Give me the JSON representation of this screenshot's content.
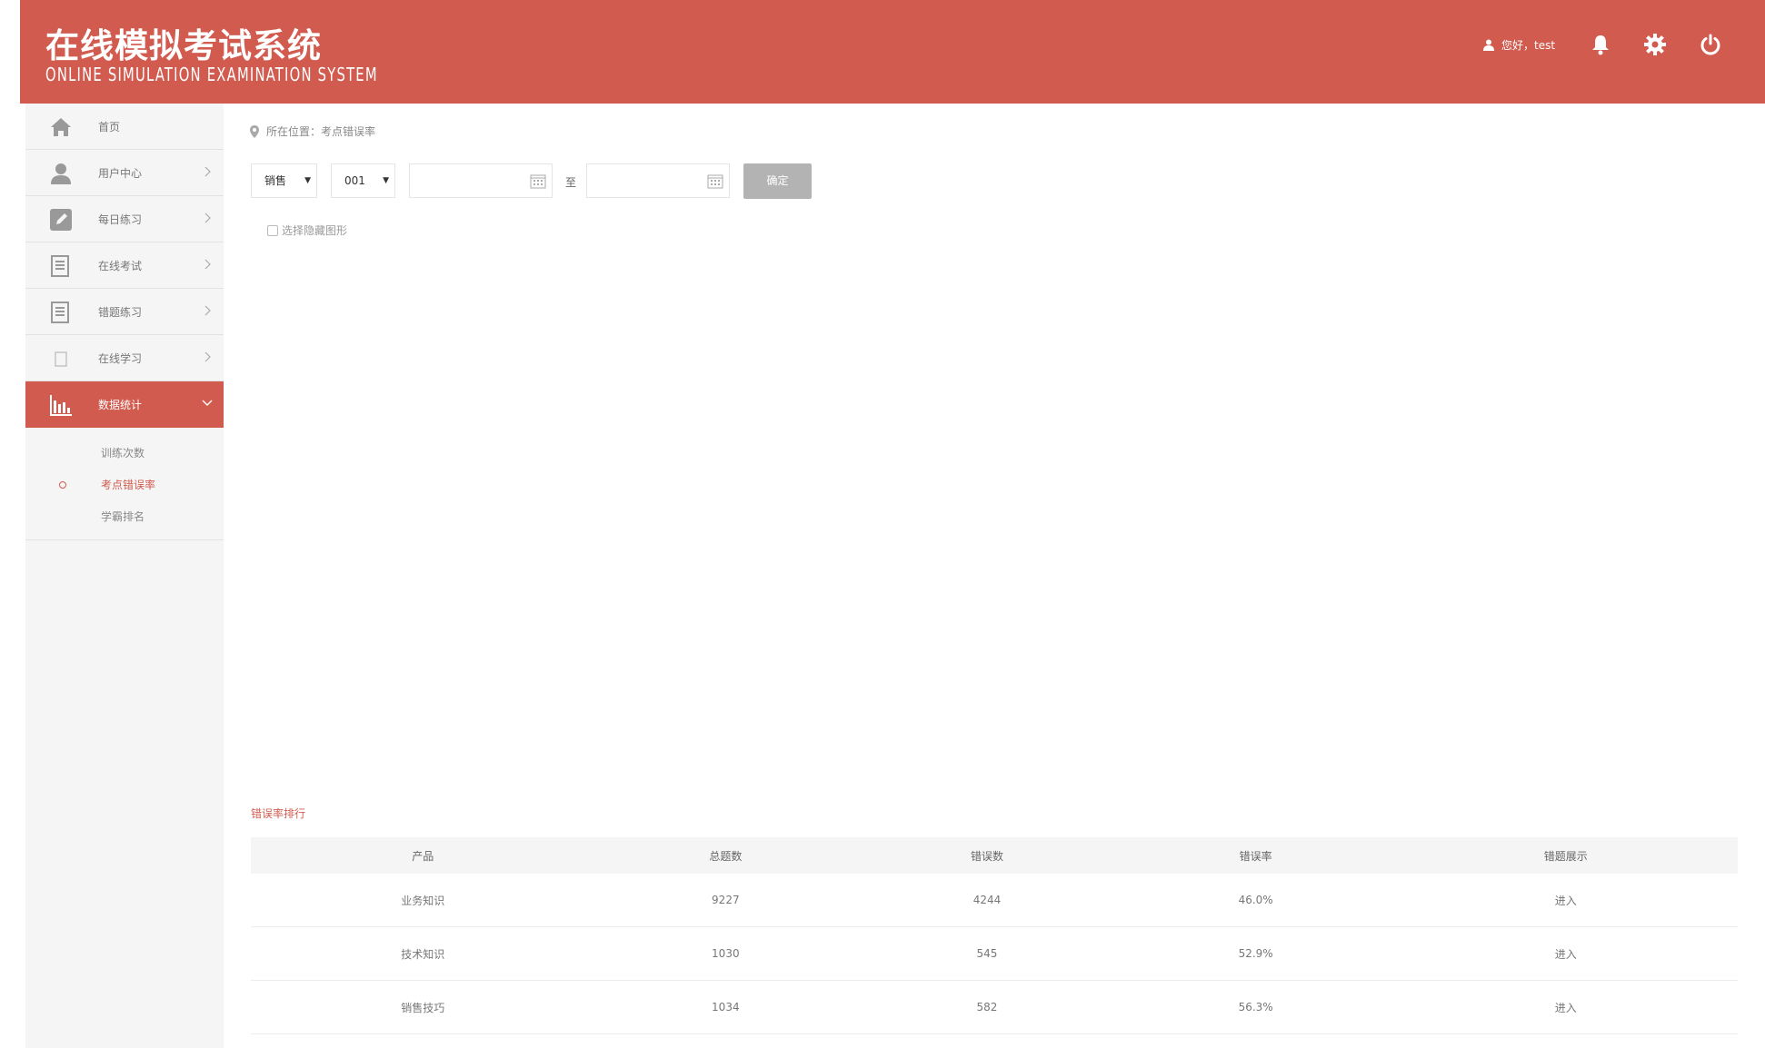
{
  "header": {
    "title_cn": "在线模拟考试系统",
    "title_en": "ONLINE SIMULATION EXAMINATION SYSTEM",
    "greeting": "您好，test",
    "icons": [
      "user-icon",
      "bell-icon",
      "gear-icon",
      "power-icon"
    ],
    "bg_color": "#d25b50"
  },
  "sidebar": {
    "items": [
      {
        "label": "首页",
        "icon": "home-icon"
      },
      {
        "label": "用户中心",
        "icon": "user-icon"
      },
      {
        "label": "每日练习",
        "icon": "edit-icon"
      },
      {
        "label": "在线考试",
        "icon": "document-icon"
      },
      {
        "label": "错题练习",
        "icon": "document-icon"
      },
      {
        "label": "在线学习",
        "icon": "book-icon"
      },
      {
        "label": "数据统计",
        "icon": "bar-chart-icon"
      }
    ],
    "submenu": [
      {
        "label": "训练次数"
      },
      {
        "label": "考点错误率"
      },
      {
        "label": "学霸排名"
      }
    ]
  },
  "breadcrumb": {
    "prefix": "所在位置：",
    "current": "考点错误率"
  },
  "filters": {
    "category": "销售",
    "code": "001",
    "start_date": "",
    "to": "至",
    "end_date": "",
    "confirm": "确定",
    "hide_chart_label": "选择隐藏图形"
  },
  "ranking": {
    "title": "错误率排行",
    "headers": [
      "产品",
      "总题数",
      "错误数",
      "错误率",
      "错题展示"
    ],
    "rows": [
      [
        "业务知识",
        "9227",
        "4244",
        "46.0%",
        "进入"
      ],
      [
        "技术知识",
        "1030",
        "545",
        "52.9%",
        "进入"
      ],
      [
        "销售技巧",
        "1034",
        "582",
        "56.3%",
        "进入"
      ]
    ]
  }
}
